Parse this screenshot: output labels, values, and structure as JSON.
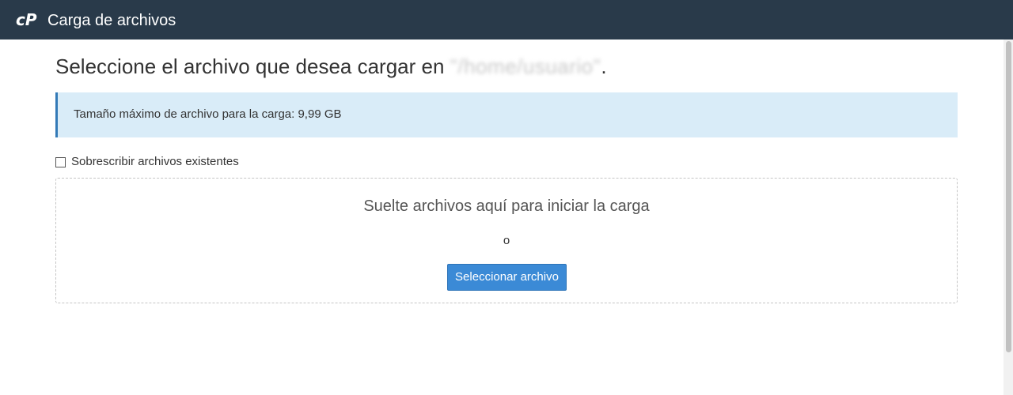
{
  "app": {
    "title": "Carga de archivos",
    "logo_icon": "cpanel-logo-icon"
  },
  "page": {
    "title_prefix": "Seleccione el archivo que desea cargar en ",
    "title_path": "\"/home/usuario\"",
    "title_suffix": "."
  },
  "info": {
    "max_size_text": "Tamaño máximo de archivo para la carga: 9,99 GB"
  },
  "overwrite": {
    "label": "Sobrescribir archivos existentes",
    "checked": false
  },
  "dropzone": {
    "drop_text": "Suelte archivos aquí para iniciar la carga",
    "or_text": "o",
    "select_button_label": "Seleccionar archivo"
  },
  "colors": {
    "topbar": "#293a4a",
    "info_background": "#d9ecf8",
    "info_border": "#337ab7",
    "button": "#3b8ad6"
  }
}
